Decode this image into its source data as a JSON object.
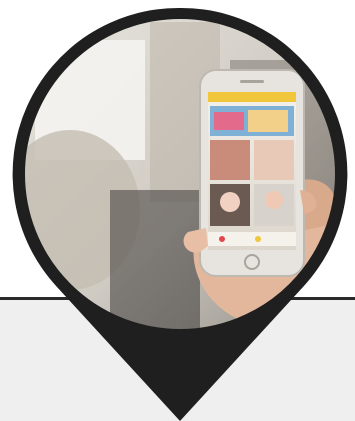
{
  "image": {
    "subject": "hand-holding-smartphone-with-video-app-icon",
    "colors": {
      "pin_outline": "#1f1f1f",
      "panel_background": "#efefef",
      "page_background": "#ffffff",
      "photo_background": "#d9d6d1",
      "phone_body": "#e7e4df",
      "phone_screen_accent": "#f0c63a"
    }
  }
}
